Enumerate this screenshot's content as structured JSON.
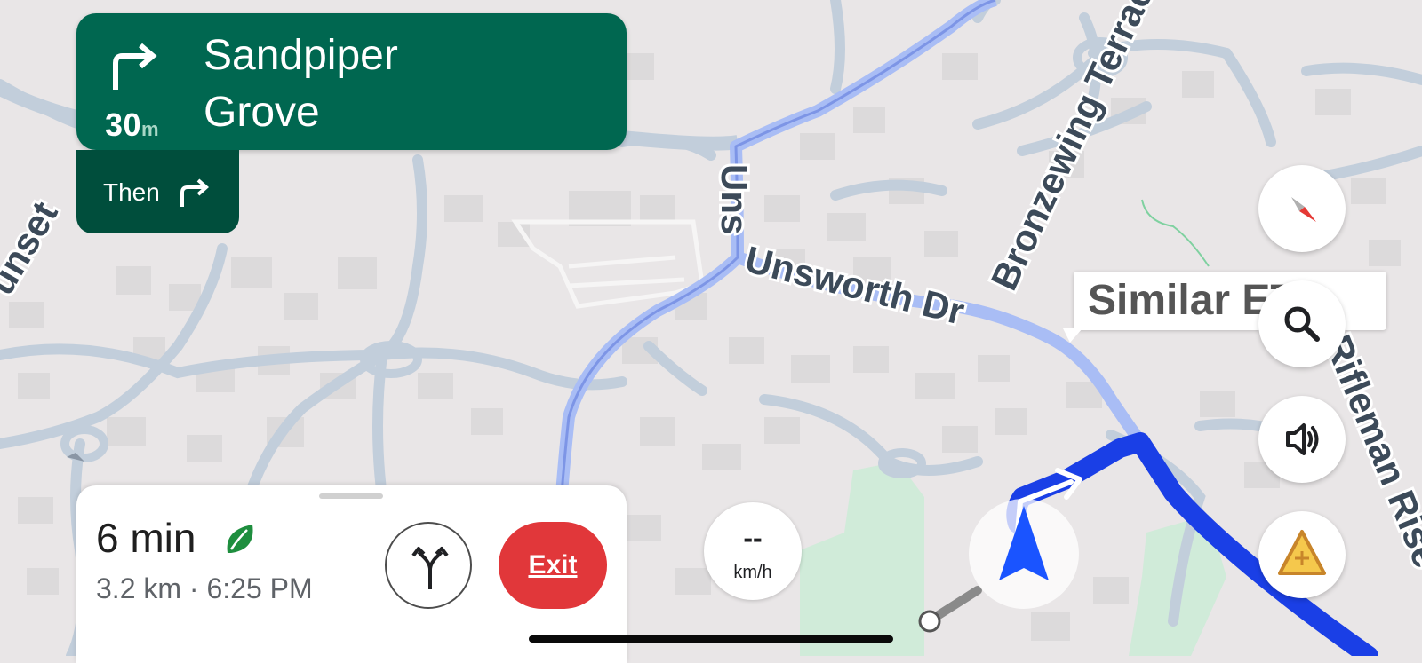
{
  "direction_banner": {
    "distance_value": "30",
    "distance_unit": "m",
    "street_line1": "Sandpiper",
    "street_line2": "Grove",
    "turn_icon": "turn-right-icon"
  },
  "then_step": {
    "label": "Then",
    "icon": "turn-right-icon"
  },
  "map_labels": {
    "unsworth": "Unsworth Dr",
    "bronzewing": "Bronzewing Terrace",
    "rifleman": "Rifleman Rise",
    "sunset": "unset"
  },
  "route_callout": {
    "text": "Similar ETA"
  },
  "speed": {
    "value": "--",
    "unit": "km/h"
  },
  "trip": {
    "duration": "6 min",
    "details": "3.2 km · 6:25 PM",
    "eco_icon": "leaf-icon",
    "alt_routes_icon": "alternate-routes-icon",
    "exit_label": "Exit"
  },
  "controls": {
    "compass_icon": "compass-icon",
    "search_icon": "search-icon",
    "sound_icon": "volume-icon",
    "report_icon": "report-incident-icon"
  },
  "colors": {
    "banner": "#006750",
    "then_box": "#004e3c",
    "route_active": "#1a3fe6",
    "route_alt": "#a9bdf5",
    "exit": "#e1373a",
    "park": "#c9ecd6",
    "map_background": "#e9e6e7",
    "minor_road": "#c2cedb"
  }
}
